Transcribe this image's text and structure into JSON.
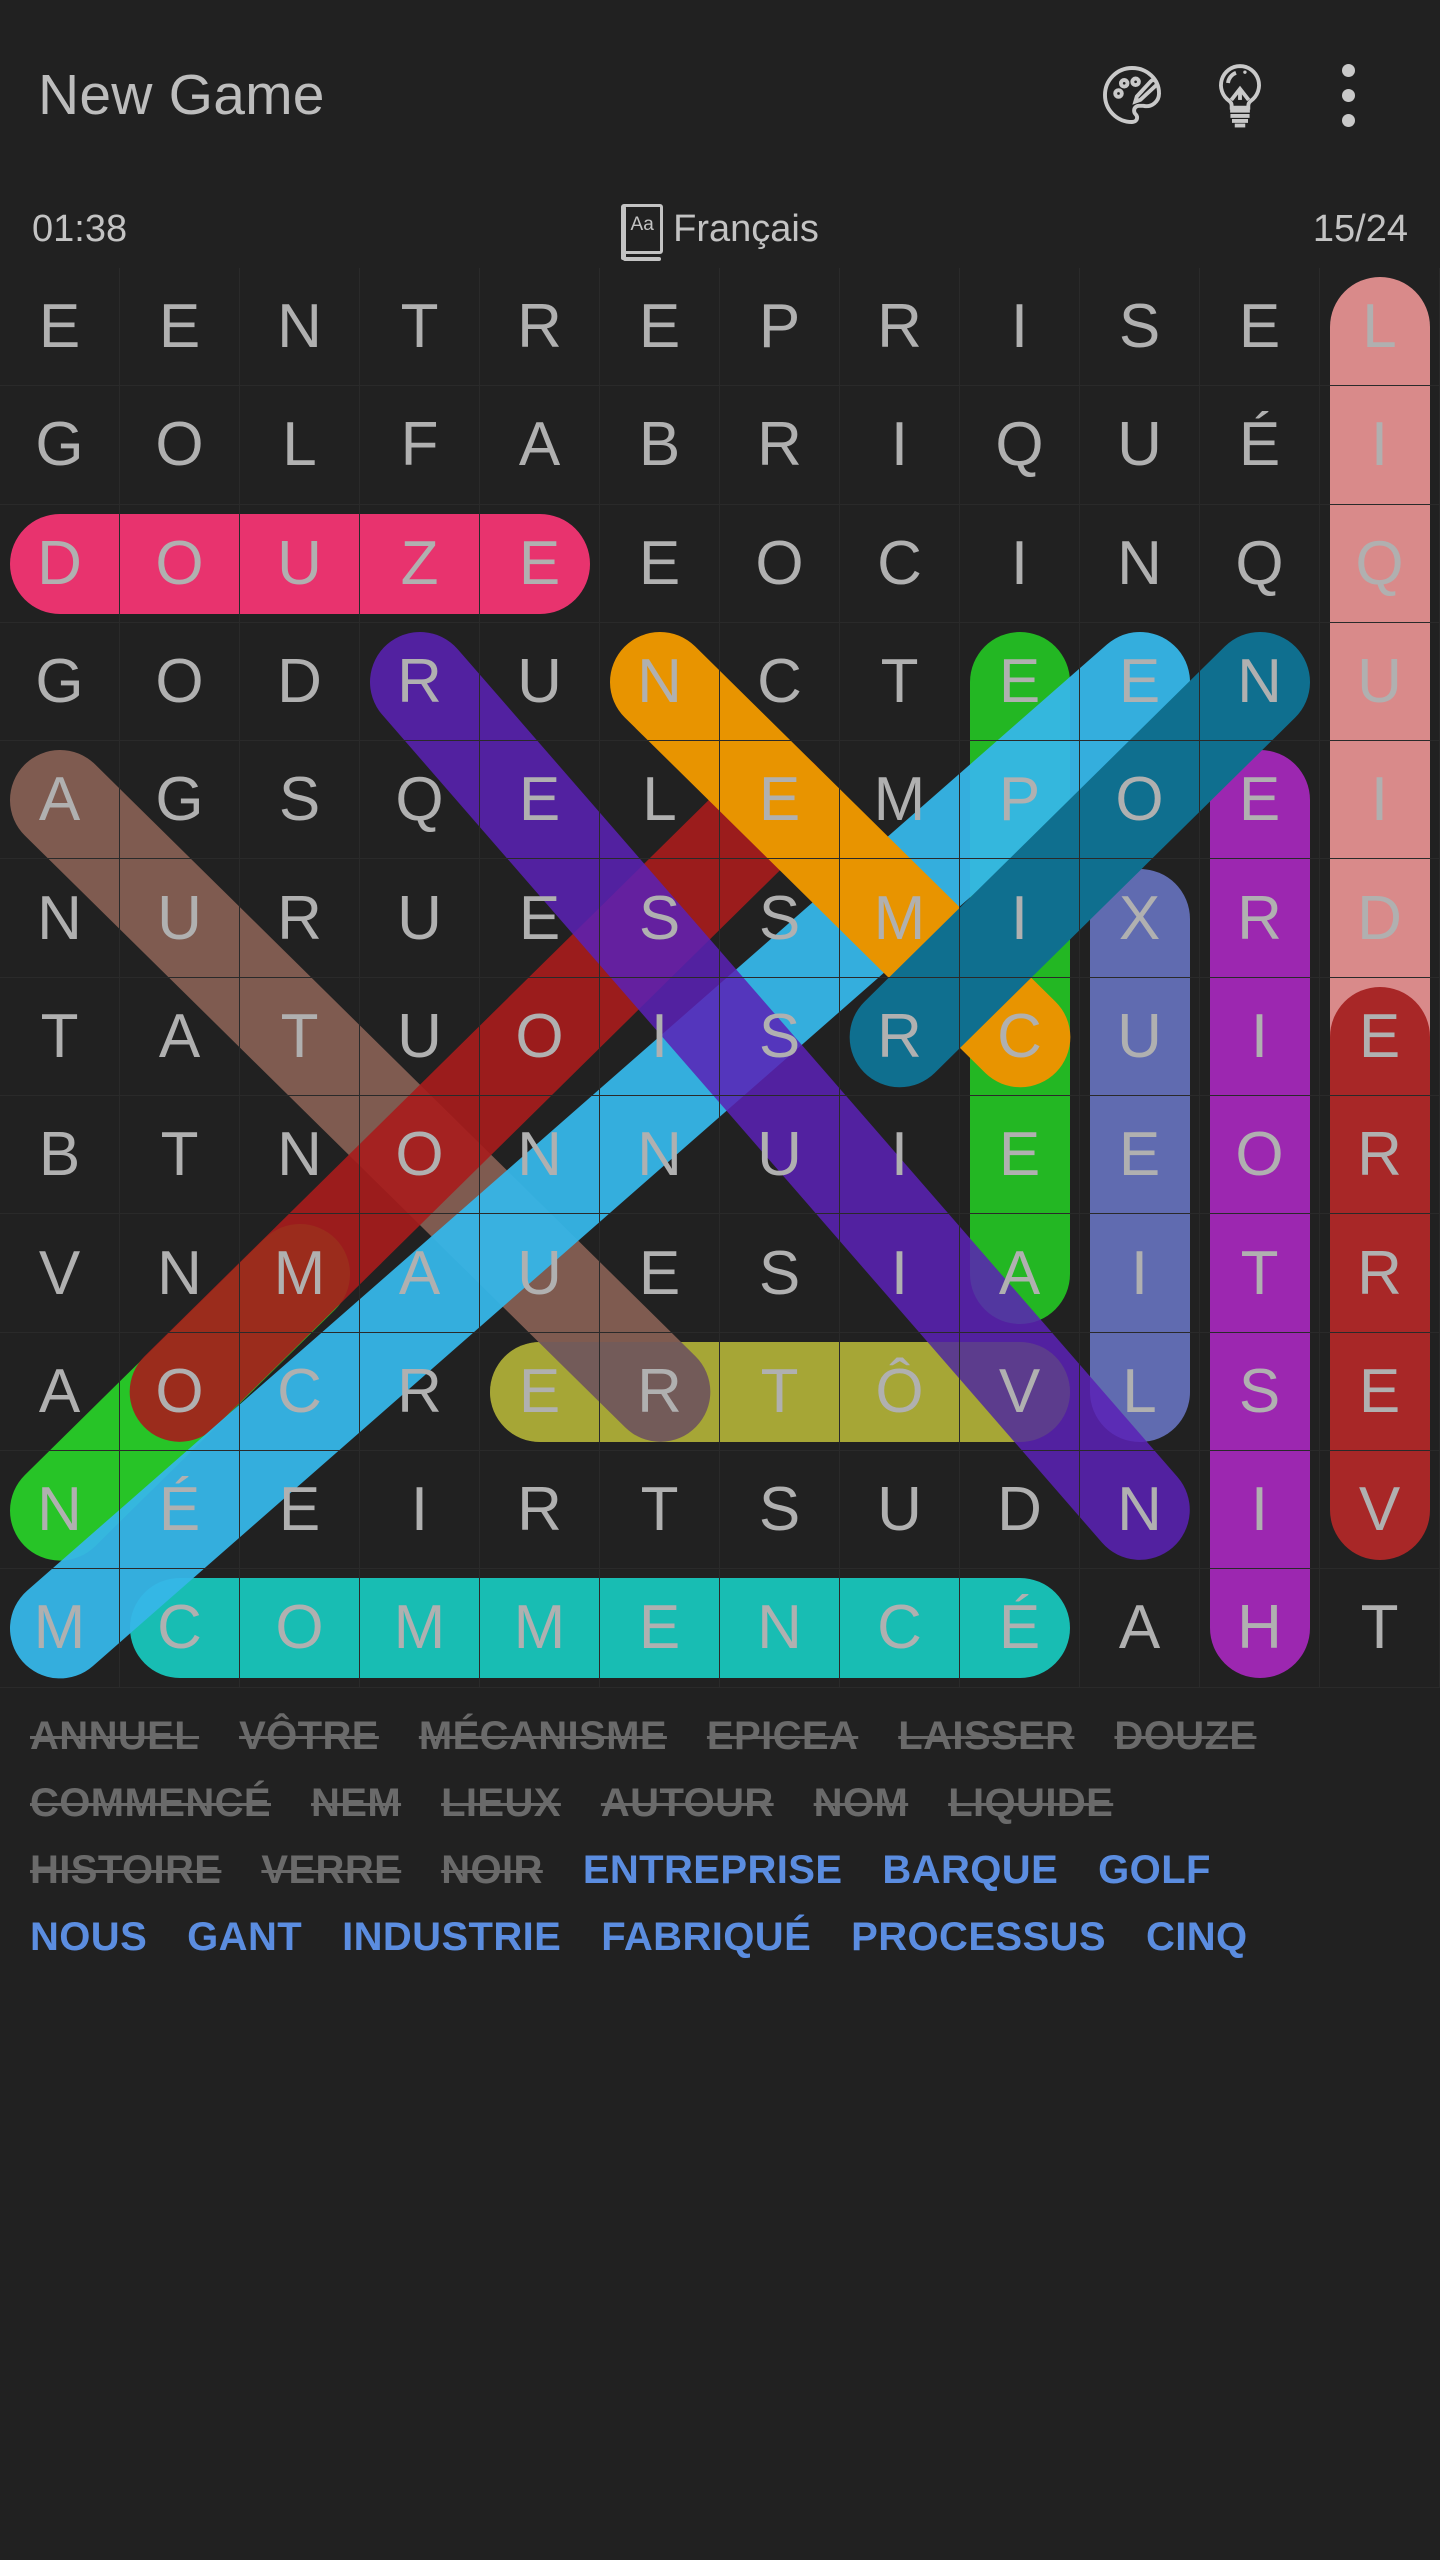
{
  "appbar": {
    "title": "New Game",
    "icons": [
      {
        "name": "palette-icon",
        "label": "Theme"
      },
      {
        "name": "lightbulb-icon",
        "label": "Hint"
      },
      {
        "name": "overflow-menu-icon",
        "label": "More options"
      }
    ]
  },
  "status": {
    "timer": "01:38",
    "language": "Français",
    "language_icon_text": "Aa",
    "progress": "15/24"
  },
  "grid": {
    "rows": 12,
    "cols": 12,
    "letters": [
      [
        "E",
        "E",
        "N",
        "T",
        "R",
        "E",
        "P",
        "R",
        "I",
        "S",
        "E",
        "L"
      ],
      [
        "G",
        "O",
        "L",
        "F",
        "A",
        "B",
        "R",
        "I",
        "Q",
        "U",
        "É",
        "I"
      ],
      [
        "D",
        "O",
        "U",
        "Z",
        "E",
        "E",
        "O",
        "C",
        "I",
        "N",
        "Q",
        "Q"
      ],
      [
        "G",
        "O",
        "D",
        "R",
        "U",
        "N",
        "C",
        "T",
        "E",
        "E",
        "N",
        "U"
      ],
      [
        "A",
        "G",
        "S",
        "Q",
        "E",
        "L",
        "E",
        "M",
        "P",
        "O",
        "E",
        "I"
      ],
      [
        "N",
        "U",
        "R",
        "U",
        "E",
        "S",
        "S",
        "M",
        "I",
        "X",
        "R",
        "D"
      ],
      [
        "T",
        "A",
        "T",
        "U",
        "O",
        "I",
        "S",
        "R",
        "C",
        "U",
        "I",
        "E"
      ],
      [
        "B",
        "T",
        "N",
        "O",
        "N",
        "N",
        "U",
        "I",
        "E",
        "E",
        "O",
        "R"
      ],
      [
        "V",
        "N",
        "M",
        "A",
        "U",
        "E",
        "S",
        "I",
        "A",
        "I",
        "T",
        "R"
      ],
      [
        "A",
        "O",
        "C",
        "R",
        "E",
        "R",
        "T",
        "Ô",
        "V",
        "L",
        "S",
        "E"
      ],
      [
        "N",
        "É",
        "E",
        "I",
        "R",
        "T",
        "S",
        "U",
        "D",
        "N",
        "I",
        "V"
      ],
      [
        "M",
        "C",
        "O",
        "M",
        "M",
        "E",
        "N",
        "C",
        "É",
        "A",
        "H",
        "T"
      ]
    ],
    "highlights": [
      {
        "word": "DOUZE",
        "color": "#e8336e",
        "opacity": 1,
        "r1": 2,
        "c1": 0,
        "r2": 2,
        "c2": 4
      },
      {
        "word": "LIQUIDE",
        "color": "#d98a8a",
        "opacity": 1,
        "r1": 0,
        "c1": 11,
        "r2": 6,
        "c2": 11
      },
      {
        "word": "ERREV",
        "color": "#a82727",
        "opacity": 1,
        "r1": 6,
        "c1": 11,
        "r2": 10,
        "c2": 11
      },
      {
        "word": "ERIOTSIH",
        "color": "#9c27b0",
        "opacity": 1,
        "r1": 4,
        "c1": 10,
        "r2": 11,
        "c2": 10
      },
      {
        "word": "XUEIL",
        "color": "#6b78c9",
        "opacity": 0.85,
        "r1": 5,
        "c1": 9,
        "r2": 9,
        "c2": 9
      },
      {
        "word": "EPICEA",
        "color": "#23b723",
        "opacity": 1,
        "r1": 3,
        "c1": 8,
        "r2": 8,
        "c2": 8
      },
      {
        "word": "ERTOV",
        "color": "#e0e01a",
        "opacity": 1,
        "r1": 9,
        "c1": 4,
        "r2": 9,
        "c2": 8
      },
      {
        "word": "COMMENCE",
        "color": "#18bdb3",
        "opacity": 1,
        "r1": 11,
        "c1": 1,
        "r2": 11,
        "c2": 8
      },
      {
        "word": "ANNUEL",
        "color": "#8a6255",
        "opacity": 0.9,
        "r1": 4,
        "c1": 0,
        "r2": 9,
        "c2": 5
      },
      {
        "word": "NOM",
        "color": "#27c427",
        "opacity": 1,
        "r1": 8,
        "c1": 2,
        "r2": 10,
        "c2": 0
      },
      {
        "word": "NEM",
        "color": "#a81c1c",
        "opacity": 0.9,
        "r1": 4,
        "c1": 6,
        "r2": 9,
        "c2": 1
      },
      {
        "word": "MECANISME",
        "color": "#36b6e8",
        "opacity": 0.95,
        "r1": 3,
        "c1": 9,
        "r2": 11,
        "c2": 0
      },
      {
        "word": "AUTOUR",
        "color": "#5b21b6",
        "opacity": 0.85,
        "r1": 3,
        "c1": 3,
        "r2": 10,
        "c2": 9
      },
      {
        "word": "LAISSER",
        "color": "#e89400",
        "opacity": 1,
        "r1": 3,
        "c1": 5,
        "r2": 6,
        "c2": 8
      },
      {
        "word": "NOIR",
        "color": "#0f6f8f",
        "opacity": 1,
        "r1": 3,
        "c1": 10,
        "r2": 6,
        "c2": 7
      },
      {
        "word": "VOTRE",
        "color": "#3a3a6e",
        "opacity": 0.35,
        "r1": 9,
        "c1": 8,
        "r2": 9,
        "c2": 4
      }
    ]
  },
  "wordlist": {
    "rows": [
      [
        {
          "text": "ANNUEL",
          "found": true
        },
        {
          "text": "VÔTRE",
          "found": true
        },
        {
          "text": "MÉCANISME",
          "found": true
        },
        {
          "text": "EPICEA",
          "found": true
        },
        {
          "text": "LAISSER",
          "found": true
        },
        {
          "text": "DOUZE",
          "found": true
        }
      ],
      [
        {
          "text": "COMMENCÉ",
          "found": true
        },
        {
          "text": "NEM",
          "found": true
        },
        {
          "text": "LIEUX",
          "found": true
        },
        {
          "text": "AUTOUR",
          "found": true
        },
        {
          "text": "NOM",
          "found": true
        },
        {
          "text": "LIQUIDE",
          "found": true
        }
      ],
      [
        {
          "text": "HISTOIRE",
          "found": true
        },
        {
          "text": "VERRE",
          "found": true
        },
        {
          "text": "NOIR",
          "found": true
        },
        {
          "text": "ENTREPRISE",
          "found": false
        },
        {
          "text": "BARQUE",
          "found": false
        },
        {
          "text": "GOLF",
          "found": false
        }
      ],
      [
        {
          "text": "NOUS",
          "found": false
        },
        {
          "text": "GANT",
          "found": false
        },
        {
          "text": "INDUSTRIE",
          "found": false
        },
        {
          "text": "FABRIQUÉ",
          "found": false
        },
        {
          "text": "PROCESSUS",
          "found": false
        },
        {
          "text": "CINQ",
          "found": false
        }
      ]
    ]
  },
  "colors": {
    "background": "#212121",
    "letter": "#b0b0b0",
    "found_word": "#6a6a6a",
    "todo_word": "#5b8de0"
  }
}
